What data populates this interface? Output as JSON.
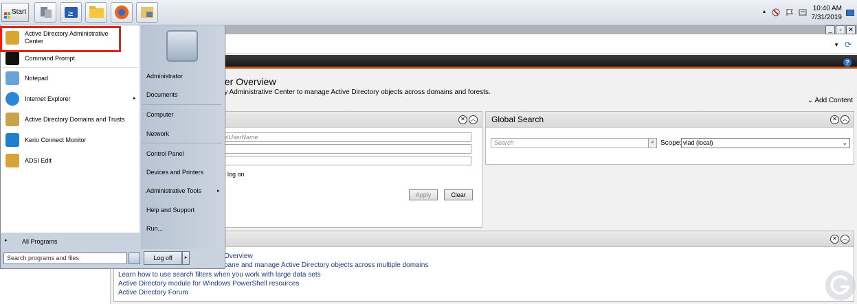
{
  "taskbar": {
    "start_label": "Start",
    "pinned_icons": [
      "server-manager-icon",
      "powershell-icon",
      "file-explorer-icon",
      "firefox-icon",
      "folder-tools-icon"
    ],
    "clock_time": "10:40 AM",
    "clock_date": "7/31/2019"
  },
  "start_menu": {
    "programs": [
      {
        "label": "Active Directory Administrative Center",
        "icon": "adac-icon",
        "color": "#d9a531"
      },
      {
        "label": "Command Prompt",
        "icon": "cmd-icon",
        "color": "#111111"
      },
      {
        "label": "Notepad",
        "icon": "notepad-icon",
        "color": "#6aa3d8"
      },
      {
        "label": "Internet Explorer",
        "icon": "ie-icon",
        "color": "#2a86d8"
      },
      {
        "label": "Active Directory Domains and Trusts",
        "icon": "domains-trusts-icon",
        "color": "#c9a24b"
      },
      {
        "label": "Kerio Connect Monitor",
        "icon": "kerio-icon",
        "color": "#1e7fd0"
      },
      {
        "label": "ADSI Edit",
        "icon": "adsi-edit-icon",
        "color": "#d8a43a"
      }
    ],
    "all_programs": "All Programs",
    "search_placeholder": "Search programs and files",
    "right_items": [
      {
        "label": "Administrator"
      },
      {
        "label": "Documents"
      },
      {
        "label": "Computer"
      },
      {
        "label": "Network"
      },
      {
        "label": "Control Panel"
      },
      {
        "label": "Devices and Printers"
      },
      {
        "label": "Administrative Tools"
      },
      {
        "label": "Help and Support"
      },
      {
        "label": "Run..."
      }
    ],
    "logoff_label": "Log off"
  },
  "adac": {
    "overview_title": "ter Overview",
    "overview_subtitle": "ry Administrative Center to manage Active Directory objects across domains and forests.",
    "add_content": "Add Content",
    "reset_panel": {
      "field_placeholder": "in\\UserName",
      "checkbox_label": "t log on",
      "apply": "Apply",
      "clear": "Clear"
    },
    "global_search": {
      "title": "Global Search",
      "search_placeholder": "Search",
      "scope_label": "Scope:",
      "scope_value": "vlad (local)"
    },
    "help_links": [
      "Overview",
      "pane and manage Active Directory objects across multiple domains",
      "Learn how to use search filters when you work with large data sets",
      "Active Directory module for Windows PowerShell resources",
      "Active Directory Forum"
    ]
  },
  "colors": {
    "highlight": "#e2231a",
    "accent_orange": "#b9571c"
  }
}
